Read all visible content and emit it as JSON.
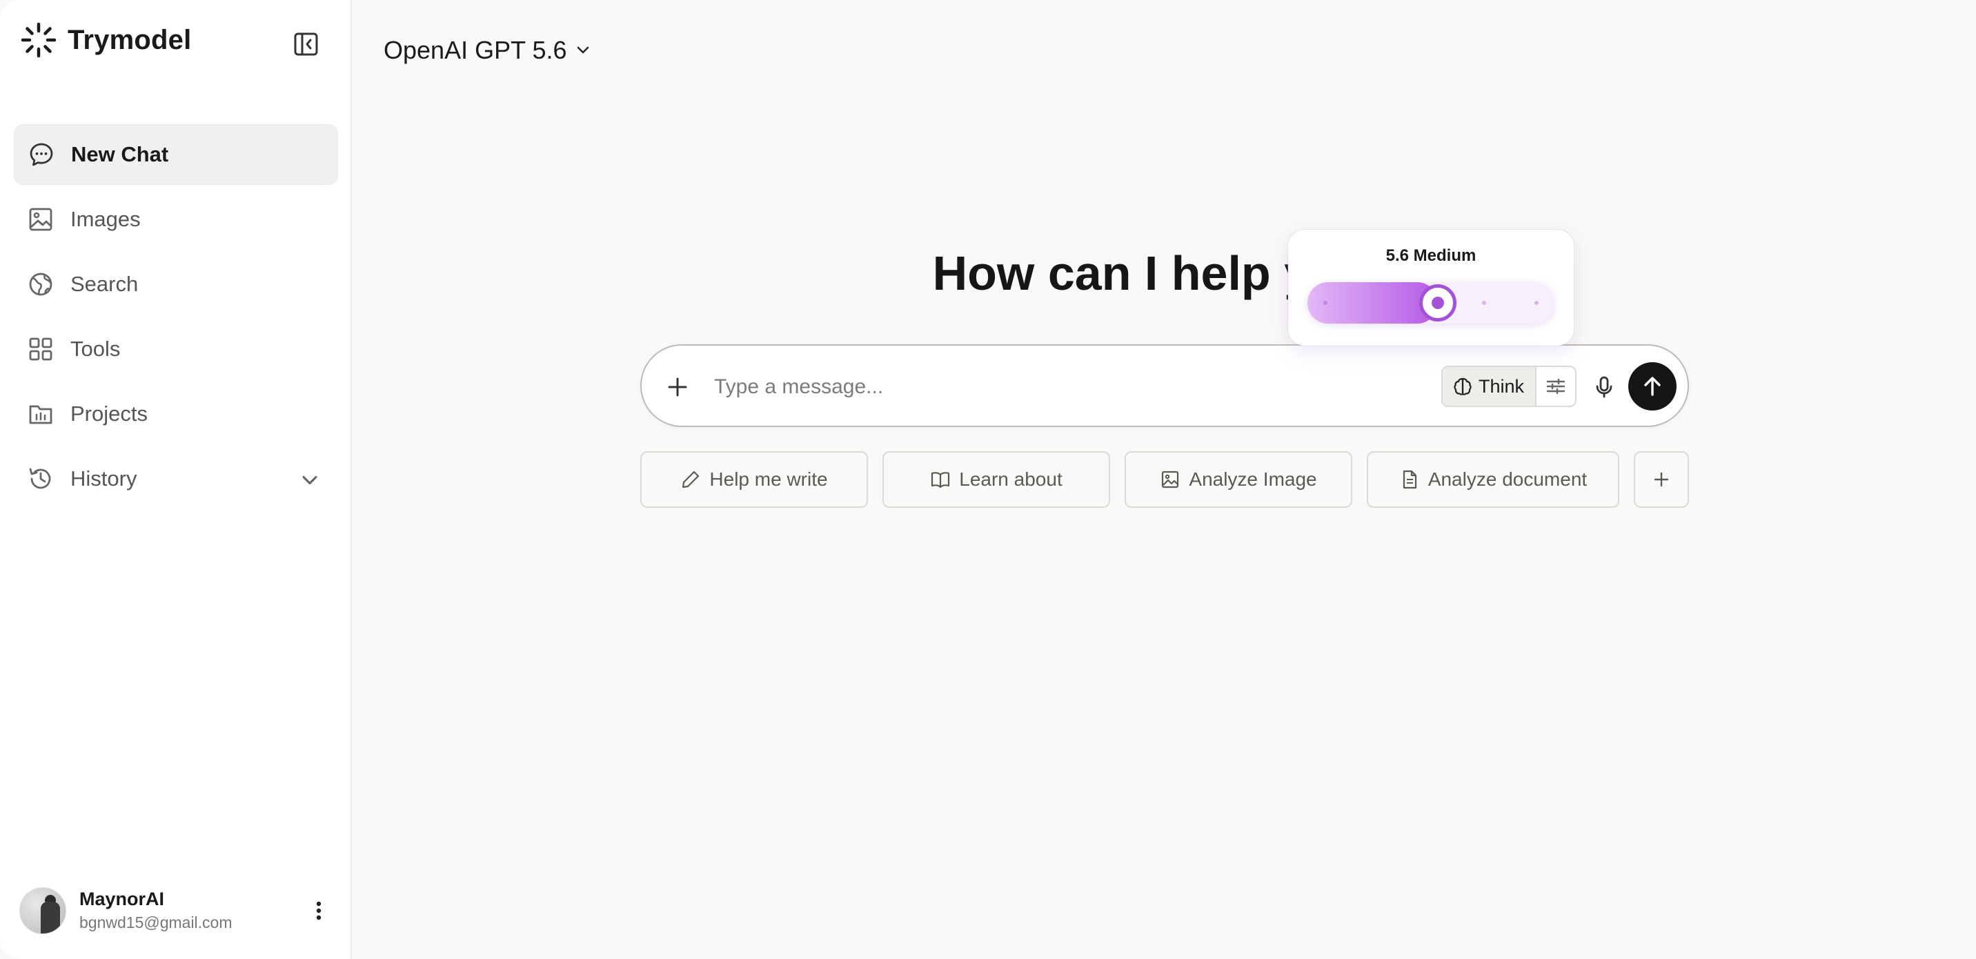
{
  "app": {
    "name": "Trymodel"
  },
  "sidebar": {
    "items": [
      {
        "label": "New Chat",
        "icon": "chat-bubble-icon",
        "active": true
      },
      {
        "label": "Images",
        "icon": "image-icon"
      },
      {
        "label": "Search",
        "icon": "globe-icon"
      },
      {
        "label": "Tools",
        "icon": "grid-icon"
      },
      {
        "label": "Projects",
        "icon": "folder-icon"
      },
      {
        "label": "History",
        "icon": "history-icon",
        "expandable": true
      }
    ]
  },
  "user": {
    "name": "MaynorAI",
    "email": "bgnwd15@gmail.com"
  },
  "header": {
    "model": "OpenAI GPT 5.6"
  },
  "main": {
    "headline": "How can I help you?",
    "composer": {
      "placeholder": "Type a message...",
      "think_label": "Think"
    },
    "suggestions": [
      {
        "label": "Help me write",
        "icon": "pencil-icon"
      },
      {
        "label": "Learn about",
        "icon": "book-icon"
      },
      {
        "label": "Analyze Image",
        "icon": "image-icon"
      },
      {
        "label": "Analyze document",
        "icon": "document-icon"
      }
    ]
  },
  "reasoning_popover": {
    "title": "5.6 Medium",
    "level_index": 2,
    "level_count": 5
  },
  "colors": {
    "accent": "#a352d6",
    "send_button": "#151515",
    "background": "#faf9f7"
  }
}
